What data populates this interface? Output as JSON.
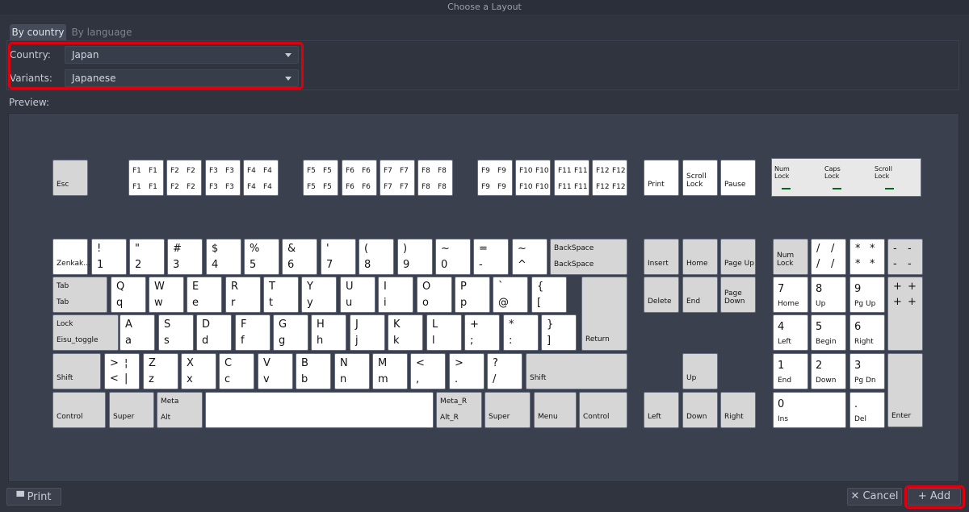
{
  "window": {
    "title": "Choose a Layout"
  },
  "tabs": [
    {
      "label": "By country"
    },
    {
      "label": "By language"
    }
  ],
  "country": {
    "label": "Country:",
    "value": "Japan"
  },
  "variant": {
    "label": "Variants:",
    "value": "Japanese"
  },
  "preview_label": "Preview:",
  "leds": [
    {
      "label": "Num Lock"
    },
    {
      "label": "Caps Lock"
    },
    {
      "label": "Scroll Lock"
    }
  ],
  "keys": [
    {
      "id": "esc",
      "kind": "mod",
      "s": "Esc"
    },
    {
      "id": "f1",
      "kind": "f",
      "q": [
        "F1",
        "F1",
        "F1",
        "F1"
      ]
    },
    {
      "id": "f2",
      "kind": "f",
      "q": [
        "F2",
        "F2",
        "F2",
        "F2"
      ]
    },
    {
      "id": "f3",
      "kind": "f",
      "q": [
        "F3",
        "F3",
        "F3",
        "F3"
      ]
    },
    {
      "id": "f4",
      "kind": "f",
      "q": [
        "F4",
        "F4",
        "F4",
        "F4"
      ]
    },
    {
      "id": "f5",
      "kind": "f",
      "q": [
        "F5",
        "F5",
        "F5",
        "F5"
      ]
    },
    {
      "id": "f6",
      "kind": "f",
      "q": [
        "F6",
        "F6",
        "F6",
        "F6"
      ]
    },
    {
      "id": "f7",
      "kind": "f",
      "q": [
        "F7",
        "F7",
        "F7",
        "F7"
      ]
    },
    {
      "id": "f8",
      "kind": "f",
      "q": [
        "F8",
        "F8",
        "F8",
        "F8"
      ]
    },
    {
      "id": "f9",
      "kind": "f",
      "q": [
        "F9",
        "F9",
        "F9",
        "F9"
      ]
    },
    {
      "id": "f10",
      "kind": "f",
      "q": [
        "F10",
        "F10",
        "F10",
        "F10"
      ]
    },
    {
      "id": "f11",
      "kind": "f",
      "q": [
        "F11",
        "F11",
        "F11",
        "F11"
      ]
    },
    {
      "id": "f12",
      "kind": "f",
      "q": [
        "F12",
        "F12",
        "F12",
        "F12"
      ]
    },
    {
      "id": "print",
      "kind": "mod-white",
      "s": "Print"
    },
    {
      "id": "scrolllock",
      "kind": "mod-white",
      "s": "Scroll Lock"
    },
    {
      "id": "pause",
      "kind": "mod-white",
      "s": "Pause"
    },
    {
      "id": "zenkaku",
      "kind": "mod-white",
      "s": "Zenkak..."
    },
    {
      "id": "k1",
      "kind": "c",
      "t": "!",
      "b": "1"
    },
    {
      "id": "k2",
      "kind": "c",
      "t": "\"",
      "b": "2"
    },
    {
      "id": "k3",
      "kind": "c",
      "t": "#",
      "b": "3"
    },
    {
      "id": "k4",
      "kind": "c",
      "t": "$",
      "b": "4"
    },
    {
      "id": "k5",
      "kind": "c",
      "t": "%",
      "b": "5"
    },
    {
      "id": "k6",
      "kind": "c",
      "t": "&",
      "b": "6"
    },
    {
      "id": "k7",
      "kind": "c",
      "t": "'",
      "b": "7"
    },
    {
      "id": "k8",
      "kind": "c",
      "t": "(",
      "b": "8"
    },
    {
      "id": "k9",
      "kind": "c",
      "t": ")",
      "b": "9"
    },
    {
      "id": "k0",
      "kind": "c",
      "t": "~",
      "b": "0"
    },
    {
      "id": "kminus",
      "kind": "c",
      "t": "=",
      "b": "-"
    },
    {
      "id": "kcaret",
      "kind": "c",
      "t": "~",
      "b": "^"
    },
    {
      "id": "backspace",
      "kind": "mod2",
      "t": "BackSpace",
      "s": "BackSpace"
    },
    {
      "id": "tab",
      "kind": "mod2",
      "t": "Tab",
      "s": "Tab"
    },
    {
      "id": "kq",
      "kind": "c",
      "t": "Q",
      "b": "q"
    },
    {
      "id": "kw",
      "kind": "c",
      "t": "W",
      "b": "w"
    },
    {
      "id": "ke",
      "kind": "c",
      "t": "E",
      "b": "e"
    },
    {
      "id": "kr",
      "kind": "c",
      "t": "R",
      "b": "r"
    },
    {
      "id": "kt",
      "kind": "c",
      "t": "T",
      "b": "t"
    },
    {
      "id": "ky",
      "kind": "c",
      "t": "Y",
      "b": "y"
    },
    {
      "id": "ku",
      "kind": "c",
      "t": "U",
      "b": "u"
    },
    {
      "id": "ki",
      "kind": "c",
      "t": "I",
      "b": "i"
    },
    {
      "id": "ko",
      "kind": "c",
      "t": "O",
      "b": "o"
    },
    {
      "id": "kp",
      "kind": "c",
      "t": "P",
      "b": "p"
    },
    {
      "id": "kat",
      "kind": "c",
      "t": "`",
      "b": "@"
    },
    {
      "id": "klbrace",
      "kind": "c",
      "t": "{",
      "b": "["
    },
    {
      "id": "return",
      "kind": "mod",
      "s": "Return"
    },
    {
      "id": "capslock",
      "kind": "mod2",
      "t": "Lock",
      "s": "Eisu_toggle"
    },
    {
      "id": "ka",
      "kind": "c",
      "t": "A",
      "b": "a"
    },
    {
      "id": "ks",
      "kind": "c",
      "t": "S",
      "b": "s"
    },
    {
      "id": "kd",
      "kind": "c",
      "t": "D",
      "b": "d"
    },
    {
      "id": "kf",
      "kind": "c",
      "t": "F",
      "b": "f"
    },
    {
      "id": "kg",
      "kind": "c",
      "t": "G",
      "b": "g"
    },
    {
      "id": "kh",
      "kind": "c",
      "t": "H",
      "b": "h"
    },
    {
      "id": "kj",
      "kind": "c",
      "t": "J",
      "b": "j"
    },
    {
      "id": "kk",
      "kind": "c",
      "t": "K",
      "b": "k"
    },
    {
      "id": "kl",
      "kind": "c",
      "t": "L",
      "b": "l"
    },
    {
      "id": "ksemi",
      "kind": "c",
      "t": "+",
      "b": ";"
    },
    {
      "id": "kcolon",
      "kind": "c",
      "t": "*",
      "b": ":"
    },
    {
      "id": "krbrace",
      "kind": "c",
      "t": "}",
      "b": "]"
    },
    {
      "id": "lshift",
      "kind": "mod",
      "s": "Shift"
    },
    {
      "id": "kless",
      "kind": "c4",
      "q": [
        ">",
        "¦",
        "<",
        "|"
      ]
    },
    {
      "id": "kz",
      "kind": "c",
      "t": "Z",
      "b": "z"
    },
    {
      "id": "kx",
      "kind": "c",
      "t": "X",
      "b": "x"
    },
    {
      "id": "kc",
      "kind": "c",
      "t": "C",
      "b": "c"
    },
    {
      "id": "kv",
      "kind": "c",
      "t": "V",
      "b": "v"
    },
    {
      "id": "kb",
      "kind": "c",
      "t": "B",
      "b": "b"
    },
    {
      "id": "kn",
      "kind": "c",
      "t": "N",
      "b": "n"
    },
    {
      "id": "km",
      "kind": "c",
      "t": "M",
      "b": "m"
    },
    {
      "id": "kcomma",
      "kind": "c",
      "t": "<",
      "b": ","
    },
    {
      "id": "kperiod",
      "kind": "c",
      "t": ">",
      "b": "."
    },
    {
      "id": "kslash",
      "kind": "c",
      "t": "?",
      "b": "/"
    },
    {
      "id": "rshift",
      "kind": "mod",
      "s": "Shift"
    },
    {
      "id": "lctrl",
      "kind": "mod",
      "s": "Control"
    },
    {
      "id": "lsuper",
      "kind": "mod",
      "s": "Super"
    },
    {
      "id": "lalt",
      "kind": "mod2",
      "t": "Meta",
      "s": "Alt"
    },
    {
      "id": "space",
      "kind": "space"
    },
    {
      "id": "ralt",
      "kind": "mod2",
      "t": "Meta_R",
      "s": "Alt_R"
    },
    {
      "id": "rsuper",
      "kind": "mod",
      "s": "Super"
    },
    {
      "id": "menu",
      "kind": "mod",
      "s": "Menu"
    },
    {
      "id": "rctrl",
      "kind": "mod",
      "s": "Control"
    },
    {
      "id": "insert",
      "kind": "mod",
      "s": "Insert"
    },
    {
      "id": "home",
      "kind": "mod",
      "s": "Home"
    },
    {
      "id": "pageup",
      "kind": "mod",
      "s": "Page Up"
    },
    {
      "id": "delete",
      "kind": "mod",
      "s": "Delete"
    },
    {
      "id": "end",
      "kind": "mod",
      "s": "End"
    },
    {
      "id": "pagedown",
      "kind": "mod",
      "s": "Page Down"
    },
    {
      "id": "up",
      "kind": "mod",
      "s": "Up"
    },
    {
      "id": "left",
      "kind": "mod",
      "s": "Left"
    },
    {
      "id": "down",
      "kind": "mod",
      "s": "Down"
    },
    {
      "id": "right",
      "kind": "mod",
      "s": "Right"
    },
    {
      "id": "numlock",
      "kind": "mod",
      "s": "Num Lock"
    },
    {
      "id": "kpdiv",
      "kind": "c4",
      "q": [
        "/",
        "/",
        "/",
        "/"
      ]
    },
    {
      "id": "kpmul",
      "kind": "c4",
      "q": [
        "*",
        "*",
        "*",
        "*"
      ]
    },
    {
      "id": "kpsub",
      "kind": "c4m",
      "q": [
        "-",
        "-",
        "-",
        "-"
      ]
    },
    {
      "id": "kp7",
      "kind": "np",
      "b": "7",
      "s": "Home"
    },
    {
      "id": "kp8",
      "kind": "np",
      "b": "8",
      "s": "Up"
    },
    {
      "id": "kp9",
      "kind": "np",
      "b": "9",
      "s": "Pg Up"
    },
    {
      "id": "kpadd",
      "kind": "c4m",
      "q": [
        "+",
        "+",
        "+",
        "+"
      ]
    },
    {
      "id": "kp4",
      "kind": "np",
      "b": "4",
      "s": "Left"
    },
    {
      "id": "kp5",
      "kind": "np",
      "b": "5",
      "s": "Begin"
    },
    {
      "id": "kp6",
      "kind": "np",
      "b": "6",
      "s": "Right"
    },
    {
      "id": "kp1",
      "kind": "np",
      "b": "1",
      "s": "End"
    },
    {
      "id": "kp2",
      "kind": "np",
      "b": "2",
      "s": "Down"
    },
    {
      "id": "kp3",
      "kind": "np",
      "b": "3",
      "s": "Pg Dn"
    },
    {
      "id": "kpenter",
      "kind": "mod",
      "s": "Enter"
    },
    {
      "id": "kp0",
      "kind": "np",
      "b": "0",
      "s": "Ins"
    },
    {
      "id": "kpdot",
      "kind": "np",
      "b": ".",
      "s": "Del"
    }
  ],
  "buttons": {
    "print": "Print",
    "cancel": "Cancel",
    "add": "Add"
  },
  "colors": {
    "highlight": "#e0000d",
    "led": "#006a1a",
    "background": "#2f343f"
  }
}
